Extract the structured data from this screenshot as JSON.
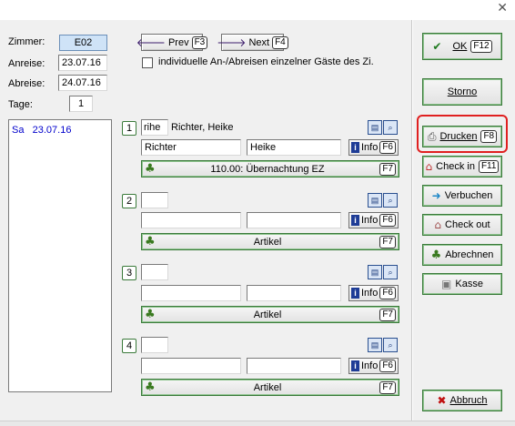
{
  "window": {
    "close_glyph": "✕"
  },
  "header": {
    "zimmer_label": "Zimmer:",
    "zimmer_value": "E02",
    "anreise_label": "Anreise:",
    "anreise_value": "23.07.16",
    "abreise_label": "Abreise:",
    "abreise_value": "24.07.16",
    "tage_label": "Tage:",
    "tage_value": "1",
    "prev_label": "Prev",
    "prev_key": "F3",
    "next_label": "Next",
    "next_key": "F4",
    "individual_checkbox_label": "individuelle An-/Abreisen einzelner Gäste des Zi.",
    "individual_checked": false
  },
  "day_list": [
    {
      "weekday": "Sa",
      "date": "23.07.16",
      "selected": true
    }
  ],
  "guests": [
    {
      "number": "1",
      "title": "rihe",
      "fullname": "Richter, Heike",
      "lastname": "Richter",
      "firstname": "Heike",
      "info_label": "Info",
      "info_key": "F6",
      "article": "110.00: Übernachtung EZ",
      "article_key": "F7"
    },
    {
      "number": "2",
      "title": "",
      "fullname": "",
      "lastname": "",
      "firstname": "",
      "info_label": "Info",
      "info_key": "F6",
      "article": "Artikel",
      "article_key": "F7"
    },
    {
      "number": "3",
      "title": "",
      "fullname": "",
      "lastname": "",
      "firstname": "",
      "info_label": "Info",
      "info_key": "F6",
      "article": "Artikel",
      "article_key": "F7"
    },
    {
      "number": "4",
      "title": "",
      "fullname": "",
      "lastname": "",
      "firstname": "",
      "info_label": "Info",
      "info_key": "F6",
      "article": "Artikel",
      "article_key": "F7"
    }
  ],
  "sidebar": {
    "ok_label": "OK",
    "ok_key": "F12",
    "storno_label": "Storno",
    "drucken_label": "Drucken",
    "drucken_key": "F8",
    "checkin_label": "Check in",
    "checkin_key": "F11",
    "verbuchen_label": "Verbuchen",
    "checkout_label": "Check out",
    "abrechnen_label": "Abrechnen",
    "kasse_label": "Kasse",
    "abbruch_label": "Abbruch"
  },
  "colors": {
    "highlight": "#e02020",
    "zimmer_bg": "#cfe3f7",
    "selected_text": "#0000cc"
  }
}
